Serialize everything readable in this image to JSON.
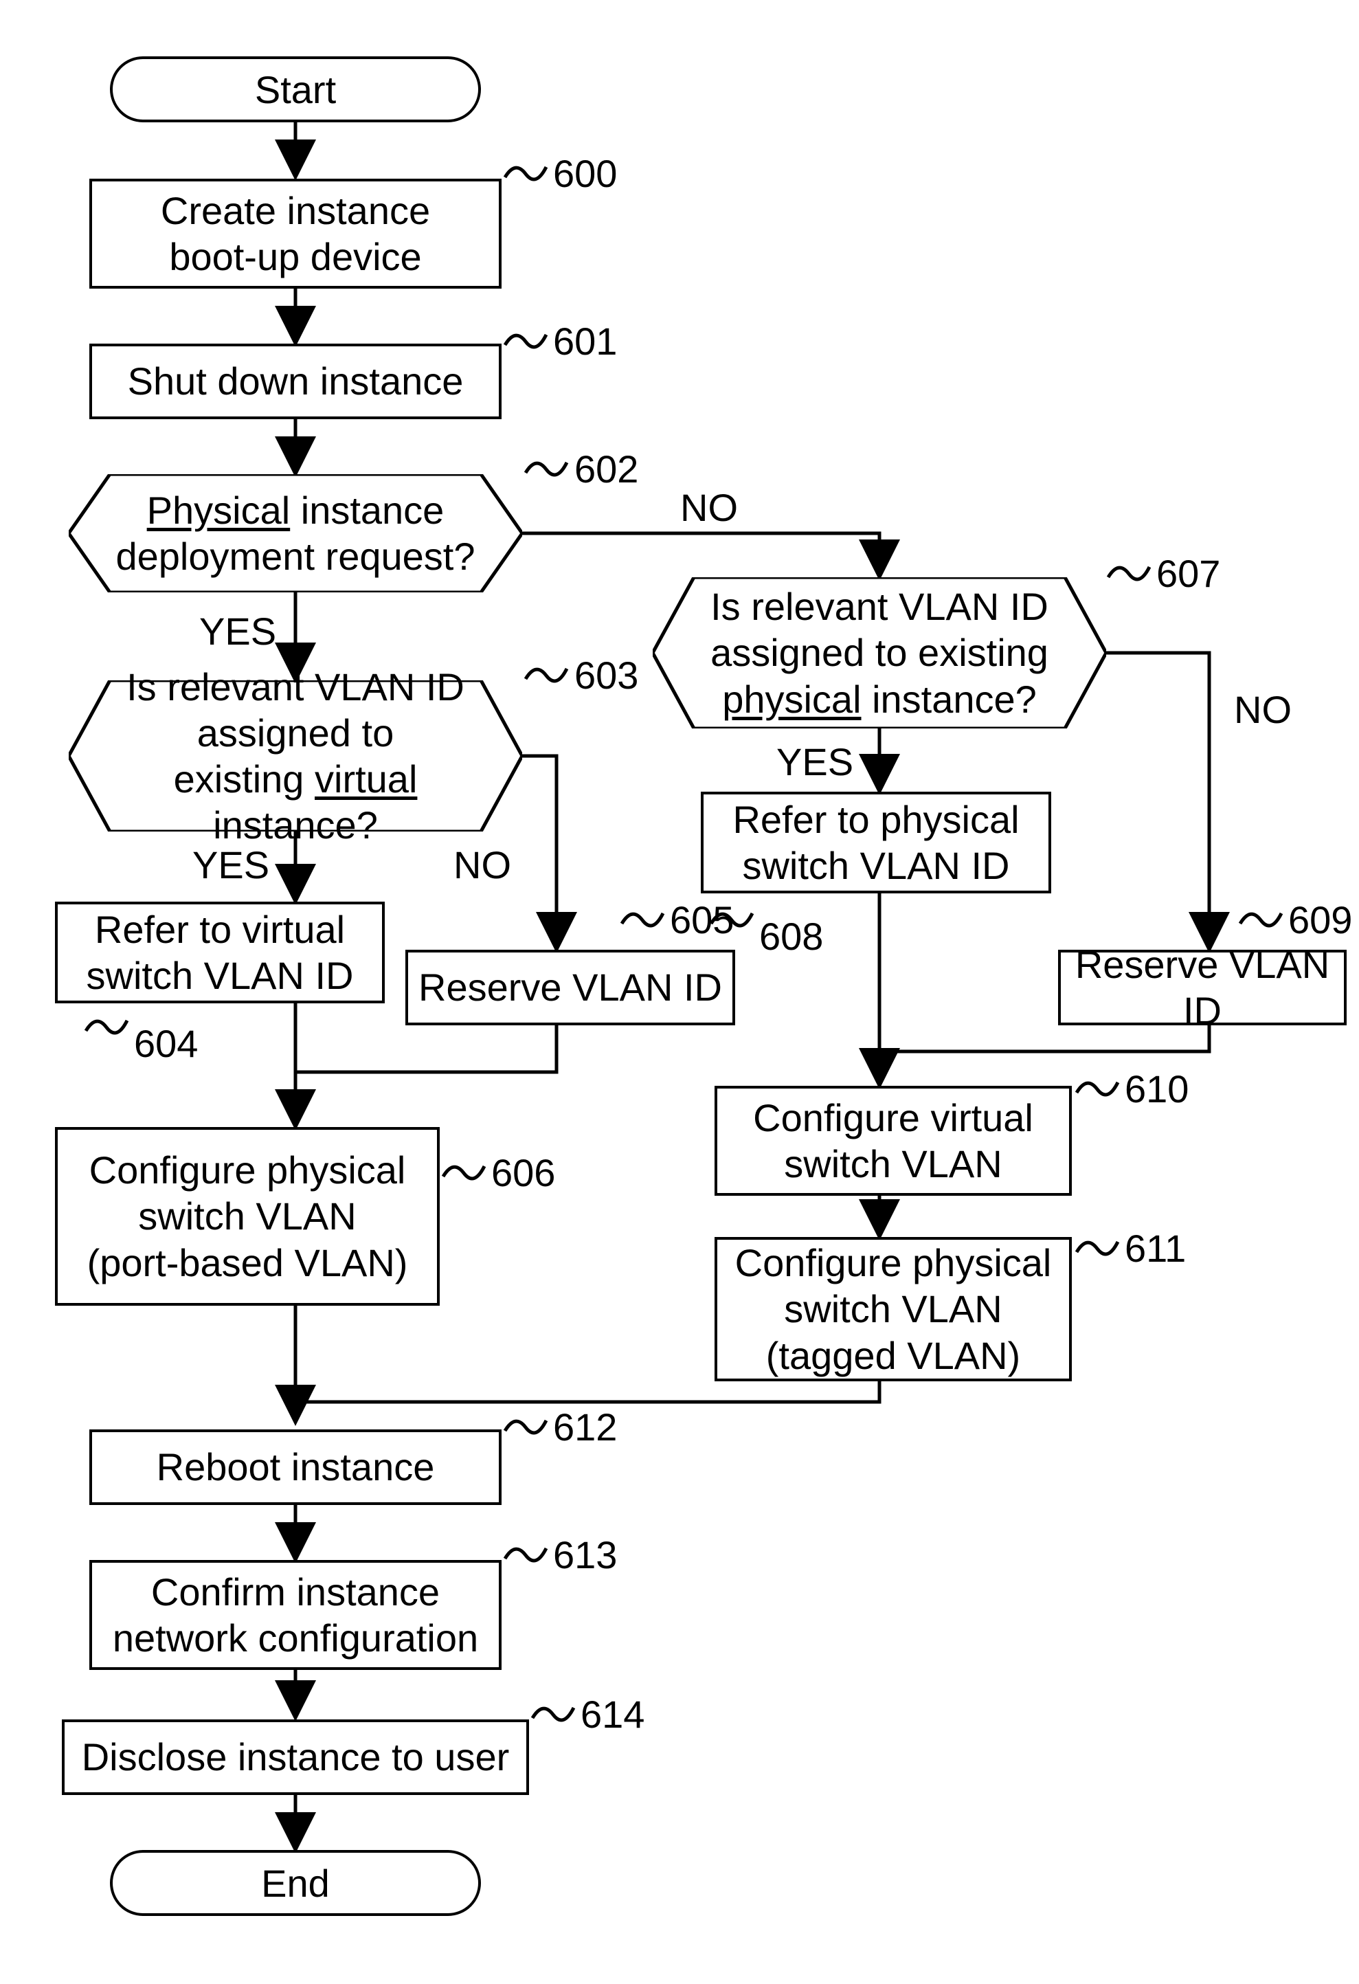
{
  "terminators": {
    "start": "Start",
    "end": "End"
  },
  "process": {
    "n600": "600",
    "n600_text_l1": "Create instance",
    "n600_text_l2": "boot-up device",
    "n601": "601",
    "n601_text": "Shut down instance",
    "n604": "604",
    "n604_text_l1": "Refer to virtual",
    "n604_text_l2": "switch VLAN ID",
    "n605": "605",
    "n605_text": "Reserve VLAN ID",
    "n606": "606",
    "n606_text_l1": "Configure physical",
    "n606_text_l2": "switch VLAN",
    "n606_text_l3": "(port-based VLAN)",
    "n608": "608",
    "n608_text_l1": "Refer to physical",
    "n608_text_l2": "switch VLAN ID",
    "n609": "609",
    "n609_text": "Reserve VLAN ID",
    "n610": "610",
    "n610_text_l1": "Configure virtual",
    "n610_text_l2": "switch VLAN",
    "n611": "611",
    "n611_text_l1": "Configure physical",
    "n611_text_l2": "switch VLAN",
    "n611_text_l3": "(tagged VLAN)",
    "n612": "612",
    "n612_text": "Reboot instance",
    "n613": "613",
    "n613_text_l1": "Confirm instance",
    "n613_text_l2": "network configuration",
    "n614": "614",
    "n614_text": "Disclose instance to user"
  },
  "decision": {
    "n602": "602",
    "n602_pre": "",
    "n602_u": "Physical",
    "n602_post": " instance",
    "n602_l2": "deployment request?",
    "n603": "603",
    "n603_l1": "Is relevant VLAN ID",
    "n603_l2_pre": "assigned to",
    "n603_l2_post": "",
    "n603_l3_pre": "existing ",
    "n603_l3_u": "virtual",
    "n603_l3_post": " instance?",
    "n607": "607",
    "n607_l1": "Is relevant VLAN ID",
    "n607_l2_pre": "assigned to existing",
    "n607_l3_u": "physical",
    "n607_l3_post": " instance?"
  },
  "labels": {
    "yes": "YES",
    "no": "NO"
  }
}
